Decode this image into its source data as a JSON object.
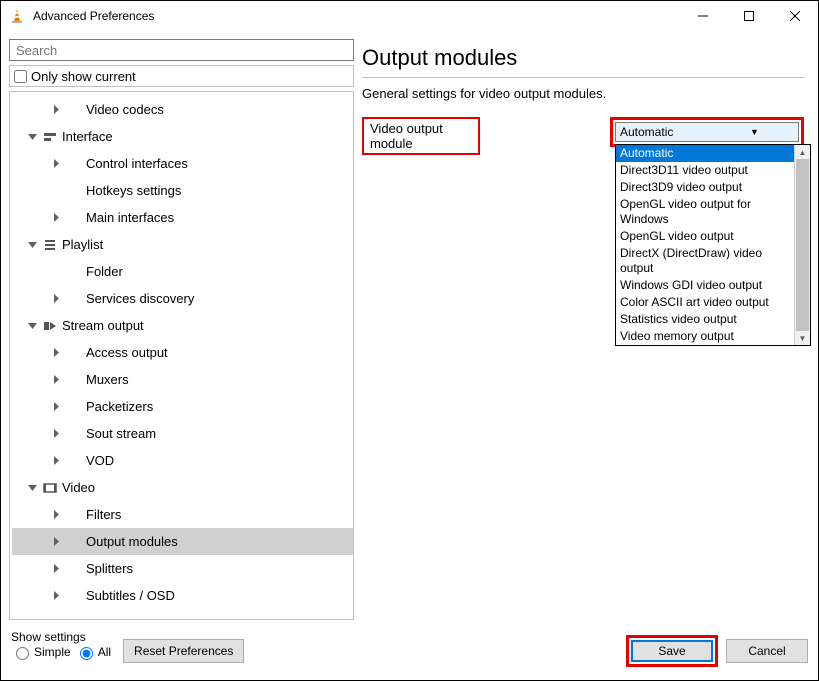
{
  "window": {
    "title": "Advanced Preferences"
  },
  "search": {
    "placeholder": "Search"
  },
  "only_show_current_label": "Only show current",
  "tree": [
    {
      "depth": 1,
      "caret": "right",
      "icon": "none",
      "label": "Video codecs",
      "selected": false
    },
    {
      "depth": 0,
      "caret": "down",
      "icon": "interface",
      "label": "Interface",
      "selected": false
    },
    {
      "depth": 1,
      "caret": "right",
      "icon": "none",
      "label": "Control interfaces",
      "selected": false
    },
    {
      "depth": 1,
      "caret": "none",
      "icon": "none",
      "label": "Hotkeys settings",
      "selected": false
    },
    {
      "depth": 1,
      "caret": "right",
      "icon": "none",
      "label": "Main interfaces",
      "selected": false
    },
    {
      "depth": 0,
      "caret": "down",
      "icon": "playlist",
      "label": "Playlist",
      "selected": false
    },
    {
      "depth": 1,
      "caret": "none",
      "icon": "none",
      "label": "Folder",
      "selected": false
    },
    {
      "depth": 1,
      "caret": "right",
      "icon": "none",
      "label": "Services discovery",
      "selected": false
    },
    {
      "depth": 0,
      "caret": "down",
      "icon": "stream",
      "label": "Stream output",
      "selected": false
    },
    {
      "depth": 1,
      "caret": "right",
      "icon": "none",
      "label": "Access output",
      "selected": false
    },
    {
      "depth": 1,
      "caret": "right",
      "icon": "none",
      "label": "Muxers",
      "selected": false
    },
    {
      "depth": 1,
      "caret": "right",
      "icon": "none",
      "label": "Packetizers",
      "selected": false
    },
    {
      "depth": 1,
      "caret": "right",
      "icon": "none",
      "label": "Sout stream",
      "selected": false
    },
    {
      "depth": 1,
      "caret": "right",
      "icon": "none",
      "label": "VOD",
      "selected": false
    },
    {
      "depth": 0,
      "caret": "down",
      "icon": "video",
      "label": "Video",
      "selected": false
    },
    {
      "depth": 1,
      "caret": "right",
      "icon": "none",
      "label": "Filters",
      "selected": false
    },
    {
      "depth": 1,
      "caret": "right",
      "icon": "none",
      "label": "Output modules",
      "selected": true
    },
    {
      "depth": 1,
      "caret": "right",
      "icon": "none",
      "label": "Splitters",
      "selected": false
    },
    {
      "depth": 1,
      "caret": "right",
      "icon": "none",
      "label": "Subtitles / OSD",
      "selected": false
    }
  ],
  "page": {
    "title": "Output modules",
    "description": "General settings for video output modules.",
    "setting_label": "Video output module",
    "combo_selected": "Automatic",
    "dropdown": [
      "Automatic",
      "Direct3D11 video output",
      "Direct3D9 video output",
      "OpenGL video output for Windows",
      "OpenGL video output",
      "DirectX (DirectDraw) video output",
      "Windows GDI video output",
      "Color ASCII art video output",
      "Statistics video output",
      "Video memory output"
    ]
  },
  "bottom": {
    "show_settings_label": "Show settings",
    "radio_simple": "Simple",
    "radio_all": "All",
    "reset_label": "Reset Preferences",
    "save_label": "Save",
    "cancel_label": "Cancel"
  }
}
